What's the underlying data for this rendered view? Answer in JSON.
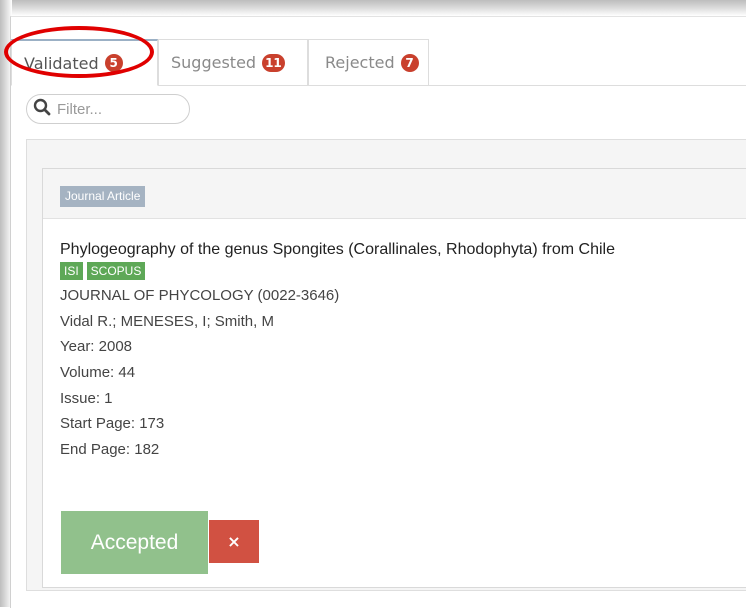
{
  "tabs": [
    {
      "label": "Validated",
      "count": "5",
      "active": true
    },
    {
      "label": "Suggested",
      "count": "11",
      "active": false
    },
    {
      "label": "Rejected",
      "count": "7",
      "active": false
    }
  ],
  "filter": {
    "placeholder": "Filter..."
  },
  "publication": {
    "type": "Journal Article",
    "title": "Phylogeography of the genus Spongites (Corallinales, Rhodophyta) from Chile",
    "indexes": [
      "ISI",
      "SCOPUS"
    ],
    "journal": "JOURNAL OF PHYCOLOGY (0022-3646)",
    "authors": "Vidal R.; MENESES, I; Smith, M",
    "year": "Year: 2008",
    "volume": "Volume: 44",
    "issue": "Issue: 1",
    "start_page": "Start Page: 173",
    "end_page": "End Page: 182"
  },
  "actions": {
    "accepted_label": "Accepted",
    "reject_symbol": "×"
  },
  "colors": {
    "badge": "#c9402d",
    "highlight_oval": "#e00000",
    "index_tag": "#5ea857",
    "type_label": "#a5b3c2",
    "accepted_button": "#91c18c",
    "reject_button": "#d15142"
  },
  "icons": {
    "filter": "search-icon",
    "reject": "close-icon"
  }
}
